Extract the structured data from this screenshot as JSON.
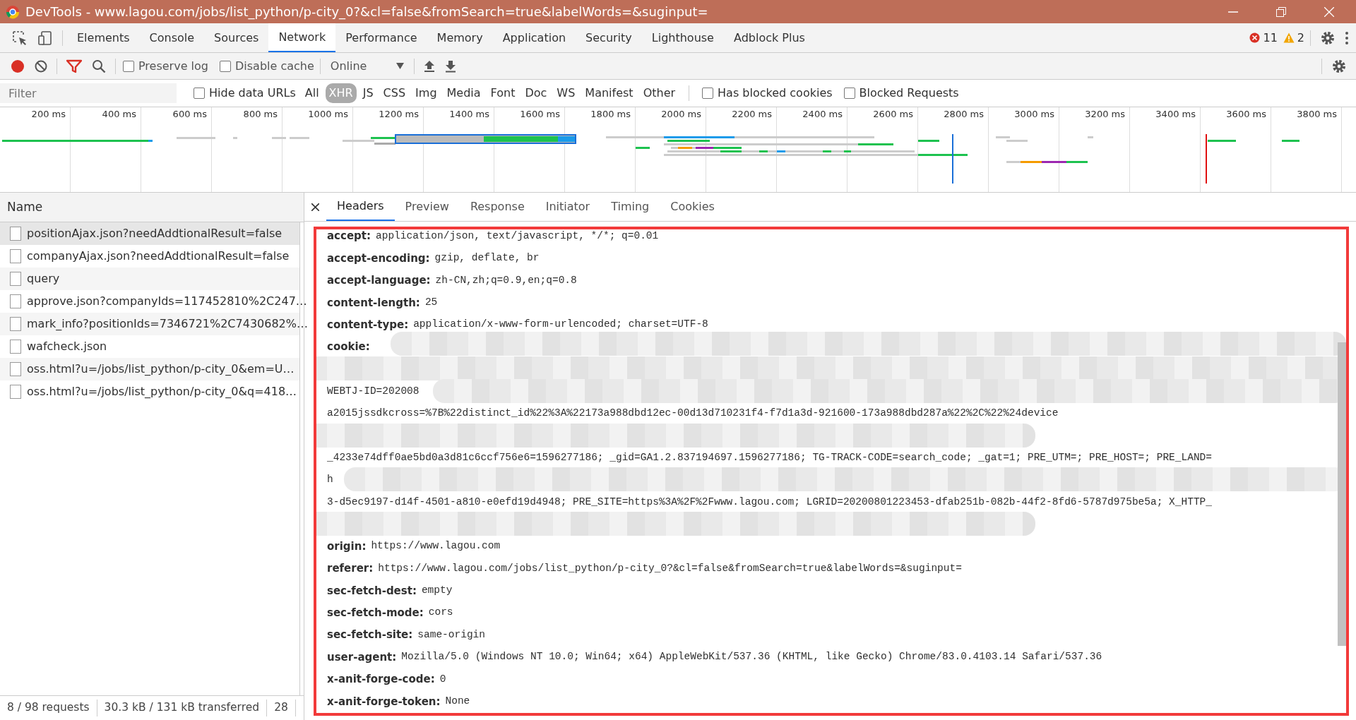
{
  "window": {
    "title": "DevTools - www.lagou.com/jobs/list_python/p-city_0?&cl=false&fromSearch=true&labelWords=&suginput="
  },
  "panel_tabs": [
    {
      "label": "Elements",
      "selected": false
    },
    {
      "label": "Console",
      "selected": false
    },
    {
      "label": "Sources",
      "selected": false
    },
    {
      "label": "Network",
      "selected": true
    },
    {
      "label": "Performance",
      "selected": false
    },
    {
      "label": "Memory",
      "selected": false
    },
    {
      "label": "Application",
      "selected": false
    },
    {
      "label": "Security",
      "selected": false
    },
    {
      "label": "Lighthouse",
      "selected": false
    },
    {
      "label": "Adblock Plus",
      "selected": false
    }
  ],
  "issues": {
    "errors": "11",
    "warnings": "2"
  },
  "toolbar": {
    "recording": true,
    "preserve_log": {
      "label": "Preserve log",
      "checked": false
    },
    "disable_cache": {
      "label": "Disable cache",
      "checked": false
    },
    "throttling": "Online"
  },
  "filter_bar": {
    "placeholder": "Filter",
    "hide_data_urls": {
      "label": "Hide data URLs",
      "checked": false
    },
    "types": [
      {
        "label": "All",
        "selected": false
      },
      {
        "label": "XHR",
        "selected": true
      },
      {
        "label": "JS",
        "selected": false
      },
      {
        "label": "CSS",
        "selected": false
      },
      {
        "label": "Img",
        "selected": false
      },
      {
        "label": "Media",
        "selected": false
      },
      {
        "label": "Font",
        "selected": false
      },
      {
        "label": "Doc",
        "selected": false
      },
      {
        "label": "WS",
        "selected": false
      },
      {
        "label": "Manifest",
        "selected": false
      },
      {
        "label": "Other",
        "selected": false
      }
    ],
    "has_blocked_cookies": {
      "label": "Has blocked cookies",
      "checked": false
    },
    "blocked_requests": {
      "label": "Blocked Requests",
      "checked": false
    }
  },
  "overview": {
    "ticks": [
      "200 ms",
      "400 ms",
      "600 ms",
      "800 ms",
      "1000 ms",
      "1200 ms",
      "1400 ms",
      "1600 ms",
      "1800 ms",
      "2000 ms",
      "2200 ms",
      "2400 ms",
      "2600 ms",
      "2800 ms",
      "3000 ms",
      "3200 ms",
      "3400 ms",
      "3600 ms",
      "3800 ms"
    ]
  },
  "requests": {
    "column": "Name",
    "rows": [
      {
        "name": "positionAjax.json?needAddtionalResult=false",
        "selected": true
      },
      {
        "name": "companyAjax.json?needAddtionalResult=false",
        "selected": false
      },
      {
        "name": "query",
        "selected": false
      },
      {
        "name": "approve.json?companyIds=117452810%2C247…",
        "selected": false
      },
      {
        "name": "mark_info?positionIds=7346721%2C7430682%…",
        "selected": false
      },
      {
        "name": "wafcheck.json",
        "selected": false
      },
      {
        "name": "oss.html?u=/jobs/list_python/p-city_0&em=U…",
        "selected": false
      },
      {
        "name": "oss.html?u=/jobs/list_python/p-city_0&q=418…",
        "selected": false
      }
    ]
  },
  "status_bar": [
    "8 / 98 requests",
    "30.3 kB / 131 kB transferred",
    "28"
  ],
  "detail_tabs": [
    {
      "label": "Headers",
      "selected": true
    },
    {
      "label": "Preview",
      "selected": false
    },
    {
      "label": "Response",
      "selected": false
    },
    {
      "label": "Initiator",
      "selected": false
    },
    {
      "label": "Timing",
      "selected": false
    },
    {
      "label": "Cookies",
      "selected": false
    }
  ],
  "headers_before": [
    {
      "name": "accept:",
      "value": "application/json, text/javascript, */*; q=0.01"
    },
    {
      "name": "accept-encoding:",
      "value": "gzip, deflate, br"
    },
    {
      "name": "accept-language:",
      "value": "zh-CN,zh;q=0.9,en;q=0.8"
    },
    {
      "name": "content-length:",
      "value": "25"
    },
    {
      "name": "content-type:",
      "value": "application/x-www-form-urlencoded; charset=UTF-8"
    }
  ],
  "cookie": {
    "name": "cookie:",
    "lines": [
      {
        "text": "WEBTJ-ID=202008",
        "redacted": true
      },
      {
        "text": "a2015jssdkcross=%7B%22distinct_id%22%3A%22173a988dbd12ec-00d13d710231f4-f7d1a3d-921600-173a988dbd287a%22%2C%22%24device",
        "redacted": false
      },
      {
        "redacted": true
      },
      {
        "text": "_4233e74dff0ae5bd0a3d81c6ccf756e6=1596277186; _gid=GA1.2.837194697.1596277186; TG-TRACK-CODE=search_code; _gat=1; PRE_UTM=; PRE_HOST=; PRE_LAND=",
        "redacted": false
      },
      {
        "text": "h",
        "redacted": true
      },
      {
        "text": "3-d5ec9197-d14f-4501-a810-e0efd19d4948; PRE_SITE=https%3A%2F%2Fwww.lagou.com; LGRID=20200801223453-dfab251b-082b-44f2-8fd6-5787d975be5a; X_HTTP_",
        "redacted": false
      },
      {
        "redacted": true
      }
    ]
  },
  "headers_after": [
    {
      "name": "origin:",
      "value": "https://www.lagou.com"
    },
    {
      "name": "referer:",
      "value": "https://www.lagou.com/jobs/list_python/p-city_0?&cl=false&fromSearch=true&labelWords=&suginput="
    },
    {
      "name": "sec-fetch-dest:",
      "value": "empty"
    },
    {
      "name": "sec-fetch-mode:",
      "value": "cors"
    },
    {
      "name": "sec-fetch-site:",
      "value": "same-origin"
    },
    {
      "name": "user-agent:",
      "value": "Mozilla/5.0 (Windows NT 10.0; Win64; x64) AppleWebKit/537.36 (KHTML, like Gecko) Chrome/83.0.4103.14 Safari/537.36"
    },
    {
      "name": "x-anit-forge-code:",
      "value": "0"
    },
    {
      "name": "x-anit-forge-token:",
      "value": "None"
    }
  ]
}
